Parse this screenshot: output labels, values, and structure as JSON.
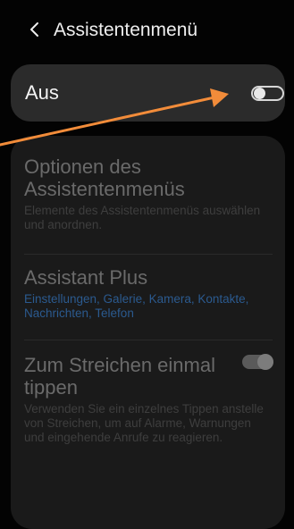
{
  "header": {
    "back_icon": "chevron-left-icon",
    "title": "Assistentenmenü"
  },
  "toggle": {
    "label": "Aus",
    "state": "off"
  },
  "settings": [
    {
      "title": "Optionen des Assistentenmenüs",
      "subtitle": "Elemente des Assistentenmenüs auswählen und anordnen."
    },
    {
      "title": "Assistant Plus",
      "subtitle": "Einstellungen, Galerie, Kamera, Kontakte, Nachrichten, Telefon"
    },
    {
      "title": "Zum Streichen einmal tippen",
      "subtitle": "Verwenden Sie ein einzelnes Tippen anstelle von Streichen, um auf Alarme, Warnungen und eingehende Anrufe zu reagieren.",
      "switch_state": "on"
    }
  ],
  "annotation": {
    "color": "#f28c3a",
    "points_to": "toggle-switch"
  },
  "colors": {
    "accent_blue": "#2b5a8f",
    "annotation_orange": "#f28c3a"
  }
}
